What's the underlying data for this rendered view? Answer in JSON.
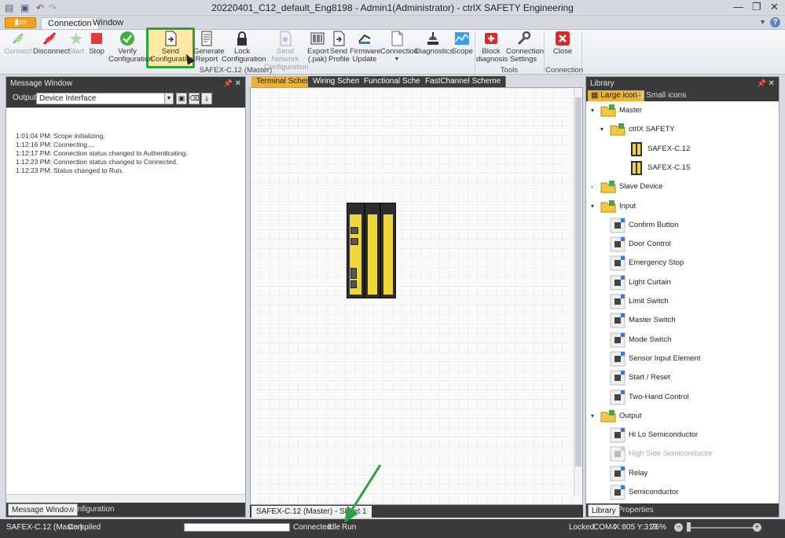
{
  "window": {
    "title": "20220401_C12_default_Eng8198 - Admin1(Administrator) - ctrlX SAFETY Engineering",
    "minimize": "—",
    "restore": "❐",
    "close": "✕"
  },
  "ribbon_tabs": [
    "Connection",
    "Window"
  ],
  "ribbon": {
    "buttons": [
      {
        "label": "Connect",
        "enabled": false
      },
      {
        "label": "Disconnect",
        "enabled": true
      },
      {
        "label": "Start",
        "enabled": false
      },
      {
        "label": "Stop",
        "enabled": true
      },
      {
        "label": "Verify\nConfiguration",
        "enabled": true
      },
      {
        "label": "Send\nConfiguration",
        "enabled": true,
        "highlighted": true
      },
      {
        "label": "Generate\nReport",
        "enabled": true
      },
      {
        "label": "Lock\nConfiguration",
        "enabled": true
      },
      {
        "label": "Send Network\nConfiguration",
        "enabled": false
      },
      {
        "label": "Export\n(.pak)",
        "enabled": true
      },
      {
        "label": "Send\nProfile",
        "enabled": true
      },
      {
        "label": "Firmware\nUpdate",
        "enabled": true
      },
      {
        "label": "Connection",
        "enabled": true
      },
      {
        "label": "Diagnostics",
        "enabled": true
      },
      {
        "label": "Scope",
        "enabled": true
      },
      {
        "label": "Block\ndiagnosis",
        "enabled": true
      },
      {
        "label": "Connection\nSettings",
        "enabled": true
      },
      {
        "label": "Close",
        "enabled": true
      }
    ],
    "group_labels": {
      "main": "SAFEX-C.12 (Master)",
      "tools": "Tools",
      "connection": "Connection"
    }
  },
  "message_window": {
    "title": "Message Window",
    "output_label": "Output",
    "output_value": "Device Interface",
    "messages": [
      {
        "time": "1:01:04 PM:",
        "text": "Scope initializing."
      },
      {
        "time": "1:12:16 PM:",
        "text": "Connecting...."
      },
      {
        "time": "1:12:17 PM:",
        "text": "Connection status changed to Authenticating."
      },
      {
        "time": "1:12:23 PM:",
        "text": "Connection status changed to Connected."
      },
      {
        "time": "1:12:23 PM:",
        "text": "Status changed to Run."
      }
    ],
    "bottom_tabs": [
      "Message Window",
      "Configuration"
    ]
  },
  "document": {
    "tabs": [
      "Terminal Scheme",
      "Wiring Scheme",
      "Functional Scheme",
      "FastChannel Scheme"
    ],
    "active_tab": "Terminal Scheme",
    "sheet_tab": "SAFEX-C.12 (Master) - Sheet 1",
    "add_sheet": "+"
  },
  "library": {
    "title": "Library",
    "tabs": [
      "Large icons",
      "Small icons"
    ],
    "tree": [
      {
        "label": "Master",
        "level": 0,
        "expanded": true,
        "icon": "folder-icon"
      },
      {
        "label": "ctrlX SAFETY",
        "level": 1,
        "expanded": true,
        "icon": "folder-icon"
      },
      {
        "label": "SAFEX-C.12",
        "level": 2,
        "icon": "device-icon"
      },
      {
        "label": "SAFEX-C.15",
        "level": 2,
        "icon": "device-icon"
      },
      {
        "label": "Slave Device",
        "level": 0,
        "expanded": false,
        "icon": "folder-icon"
      },
      {
        "label": "Input",
        "level": 0,
        "expanded": true,
        "icon": "folder-icon"
      },
      {
        "label": "Confirm Button",
        "level": 1,
        "icon": "confirm-button-icon"
      },
      {
        "label": "Door Control",
        "level": 1,
        "icon": "door-control-icon"
      },
      {
        "label": "Emergency Stop",
        "level": 1,
        "icon": "emergency-stop-icon"
      },
      {
        "label": "Light Curtain",
        "level": 1,
        "icon": "light-curtain-icon"
      },
      {
        "label": "Limit Switch",
        "level": 1,
        "icon": "limit-switch-icon"
      },
      {
        "label": "Master Switch",
        "level": 1,
        "icon": "master-switch-icon"
      },
      {
        "label": "Mode Switch",
        "level": 1,
        "icon": "mode-switch-icon"
      },
      {
        "label": "Sensor Input Element",
        "level": 1,
        "icon": "sensor-input-icon"
      },
      {
        "label": "Start / Reset",
        "level": 1,
        "icon": "start-reset-icon"
      },
      {
        "label": "Two-Hand Control",
        "level": 1,
        "icon": "two-hand-control-icon"
      },
      {
        "label": "Output",
        "level": 0,
        "expanded": true,
        "icon": "folder-icon"
      },
      {
        "label": "Hi Lo Semiconductor",
        "level": 1,
        "icon": "hilo-semiconductor-icon"
      },
      {
        "label": "High Side Semiconductor",
        "level": 1,
        "icon": "high-side-semiconductor-icon",
        "disabled": true
      },
      {
        "label": "Relay",
        "level": 1,
        "icon": "relay-icon"
      },
      {
        "label": "Semiconductor",
        "level": 1,
        "icon": "semiconductor-icon"
      }
    ],
    "bottom_tabs": [
      "Library",
      "Properties"
    ]
  },
  "statusbar": {
    "device": "SAFEX-C.12 (Master)",
    "compile_state": "Compiled",
    "connection": "Connected",
    "mode": "Idle",
    "run": "Run",
    "locked": "Locked",
    "port": "COM4",
    "coords": "X:805 Y:319",
    "zoom": "75%"
  },
  "colors": {
    "accent": "#e8b33a",
    "highlight_border": "#2ea043",
    "panel_header": "#3a3a3a"
  }
}
